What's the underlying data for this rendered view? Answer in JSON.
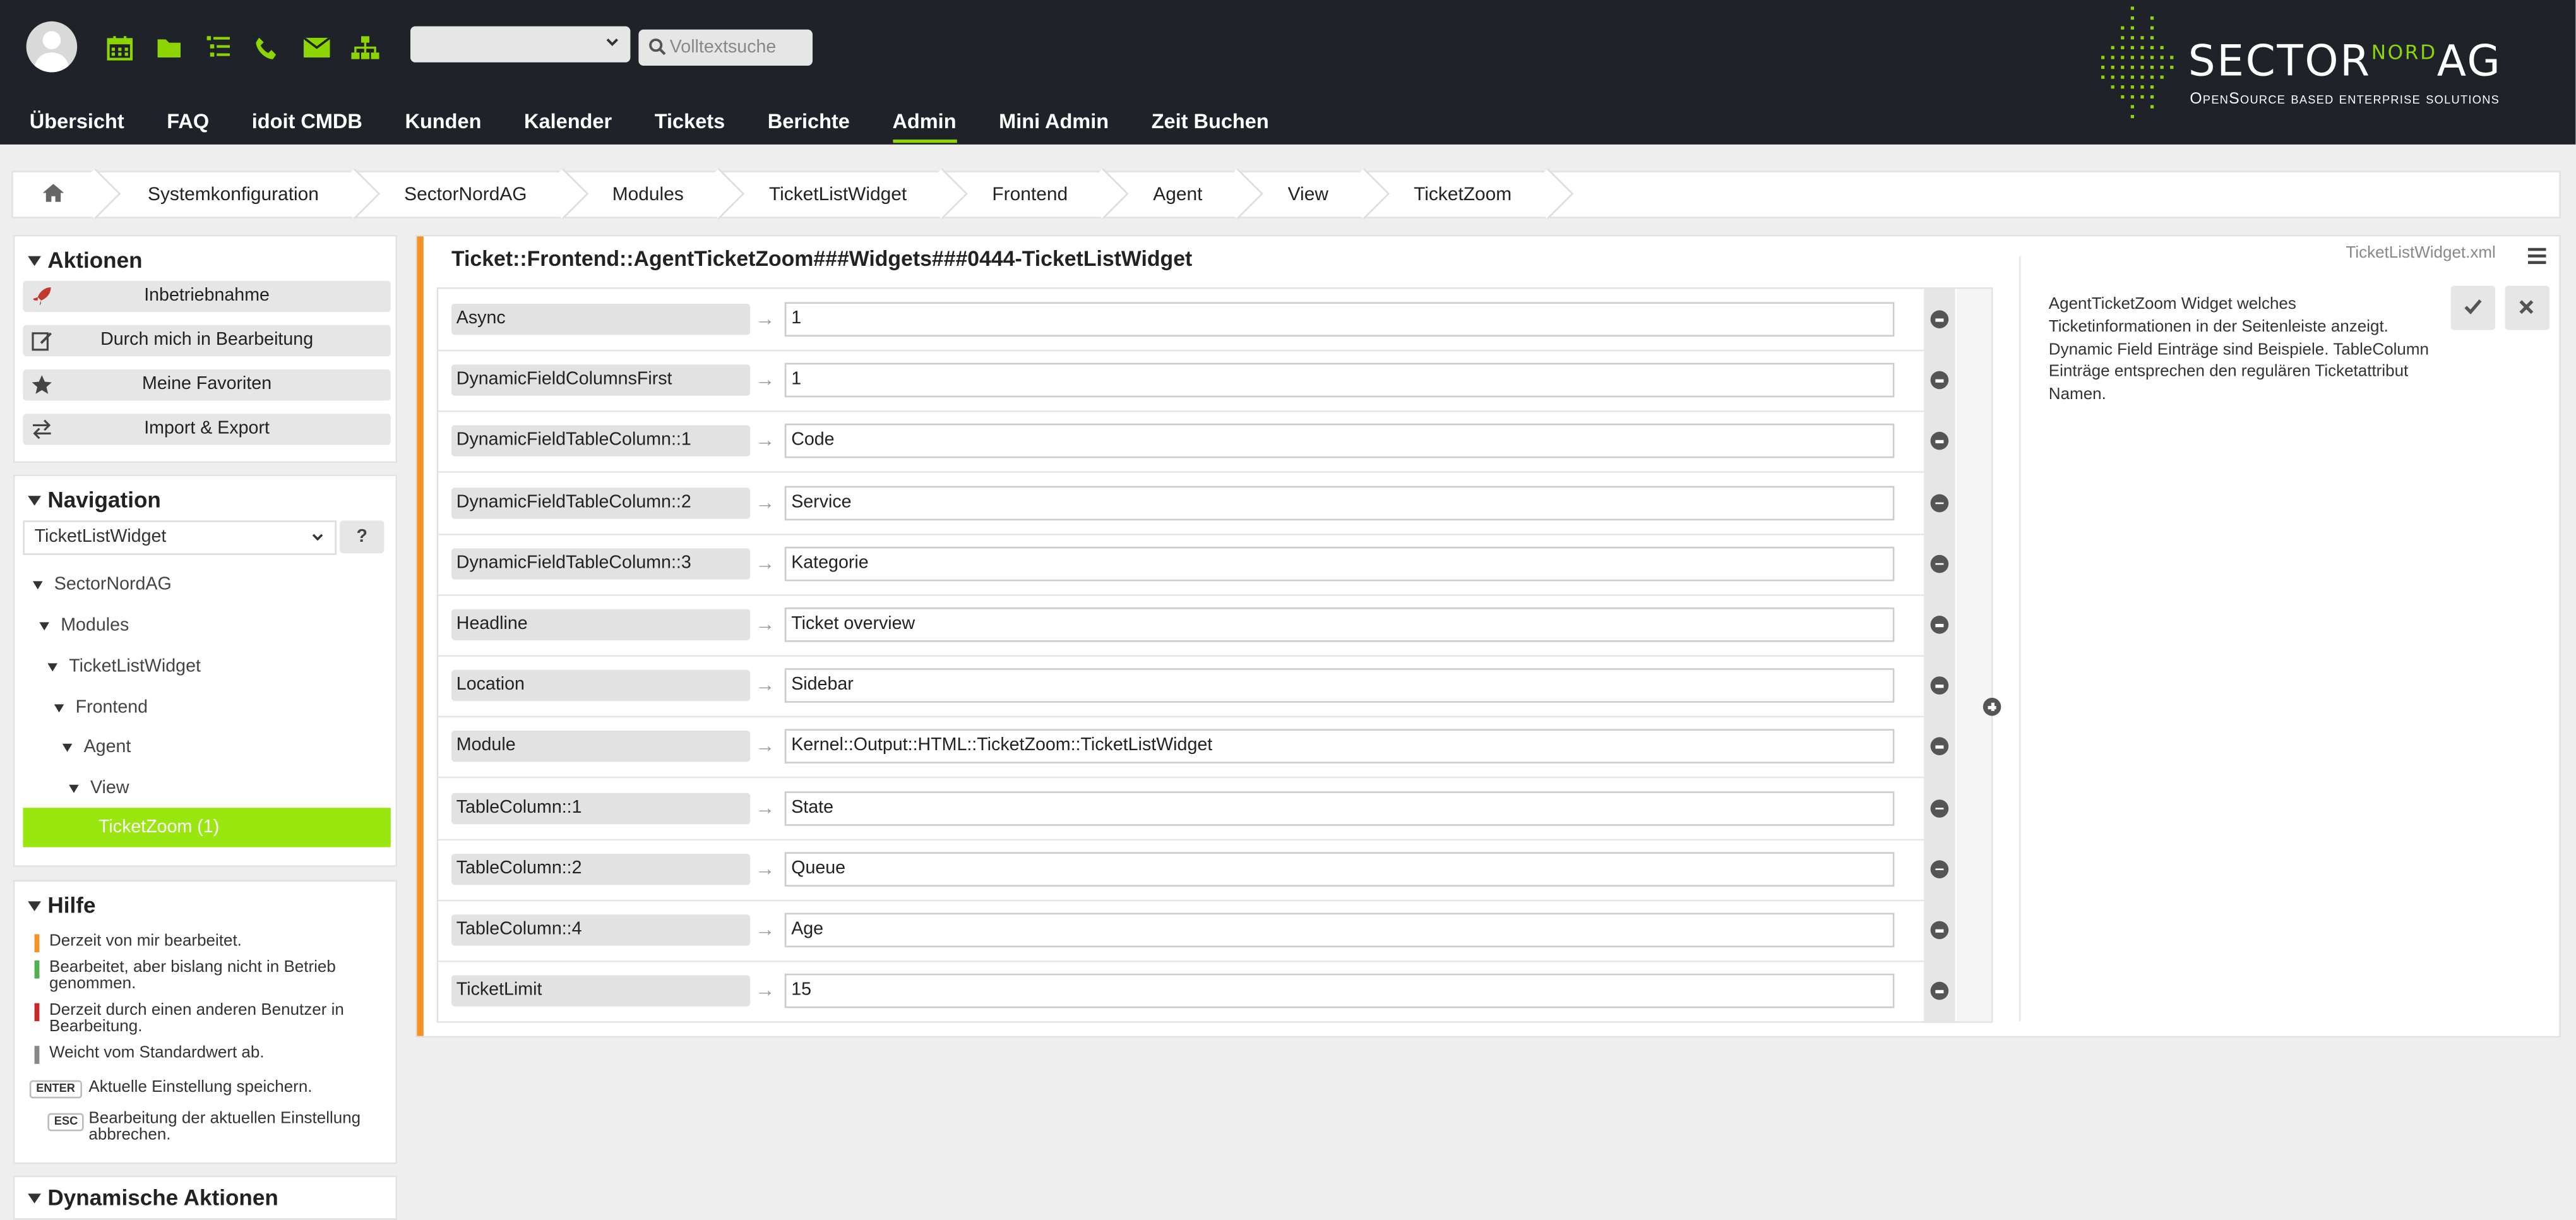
{
  "header": {
    "search_placeholder": "Volltextsuche",
    "nav": [
      "Übersicht",
      "FAQ",
      "idoit CMDB",
      "Kunden",
      "Kalender",
      "Tickets",
      "Berichte",
      "Admin",
      "Mini Admin",
      "Zeit Buchen"
    ],
    "active_nav": "Admin",
    "logo_brand": "SECTOR",
    "logo_nord": "NORD",
    "logo_ag": "AG",
    "logo_tagline": "OpenSource based enterprise solutions",
    "icons": [
      "calendar-icon",
      "folder-icon",
      "list-icon",
      "phone-icon",
      "mail-icon",
      "sitemap-icon"
    ]
  },
  "breadcrumb": [
    "Systemkonfiguration",
    "SectorNordAG",
    "Modules",
    "TicketListWidget",
    "Frontend",
    "Agent",
    "View",
    "TicketZoom"
  ],
  "sidebar": {
    "actions_title": "Aktionen",
    "actions": [
      "Inbetriebnahme",
      "Durch mich in Bearbeitung",
      "Meine Favoriten",
      "Import & Export"
    ],
    "navigation_title": "Navigation",
    "navigation_select": "TicketListWidget",
    "help_button": "?",
    "tree": [
      "SectorNordAG",
      "Modules",
      "TicketListWidget",
      "Frontend",
      "Agent",
      "View"
    ],
    "tree_selected": "TicketZoom (1)",
    "help_title": "Hilfe",
    "help_items": [
      {
        "color": "#f39325",
        "text": "Derzeit von mir bearbeitet."
      },
      {
        "color": "#4caf50",
        "text": "Bearbeitet, aber bislang nicht in Betrieb genommen."
      },
      {
        "color": "#c62828",
        "text": "Derzeit durch einen anderen Benutzer in Bearbeitung."
      },
      {
        "color": "#888888",
        "text": "Weicht vom Standardwert ab."
      }
    ],
    "kbd_enter": "ENTER",
    "kbd_enter_text": "Aktuelle Einstellung speichern.",
    "kbd_esc": "ESC",
    "kbd_esc_text": "Bearbeitung der aktuellen Einstellung abbrechen.",
    "dyn_title": "Dynamische Aktionen"
  },
  "setting": {
    "title": "Ticket::Frontend::AgentTicketZoom###Widgets###0444-TicketListWidget",
    "file": "TicketListWidget.xml",
    "rows": [
      {
        "key": "Async",
        "value": "1"
      },
      {
        "key": "DynamicFieldColumnsFirst",
        "value": "1"
      },
      {
        "key": "DynamicFieldTableColumn::1",
        "value": "Code"
      },
      {
        "key": "DynamicFieldTableColumn::2",
        "value": "Service"
      },
      {
        "key": "DynamicFieldTableColumn::3",
        "value": "Kategorie"
      },
      {
        "key": "Headline",
        "value": "Ticket overview"
      },
      {
        "key": "Location",
        "value": "Sidebar"
      },
      {
        "key": "Module",
        "value": "Kernel::Output::HTML::TicketZoom::TicketListWidget"
      },
      {
        "key": "TableColumn::1",
        "value": "State"
      },
      {
        "key": "TableColumn::2",
        "value": "Queue"
      },
      {
        "key": "TableColumn::4",
        "value": "Age"
      },
      {
        "key": "TicketLimit",
        "value": "15"
      }
    ],
    "description": "AgentTicketZoom Widget welches Ticketinformationen in der Seitenleiste anzeigt. Dynamic Field Einträge sind Beispiele. TableColumn Einträge entsprechen den regulären Ticketattribut Namen."
  },
  "colors": {
    "accent": "#8cd500",
    "selected": "#9ae60f",
    "modified": "#f39325",
    "header": "#1f2329"
  }
}
